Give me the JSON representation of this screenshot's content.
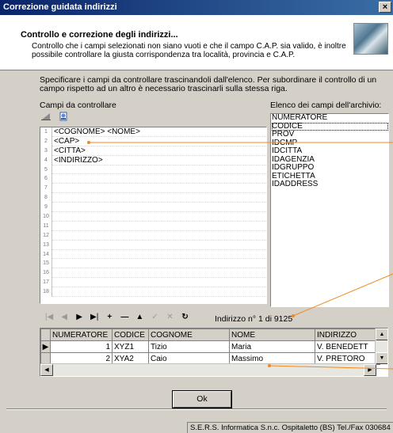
{
  "window": {
    "title": "Correzione guidata indirizzi",
    "close": "×"
  },
  "header": {
    "title": "Controllo e correzione degli indirizzi...",
    "description": "Controllo che i campi selezionati non siano vuoti e che il campo C.A.P. sia valido, è inoltre possibile controllare la giusta corrispondenza tra località, provincia e C.A.P."
  },
  "instructions": "Specificare i campi da controllare trascinandoli dall'elenco. Per subordinare il controllo di un campo rispetto ad un altro è necessario trascinarli sulla stessa riga.",
  "left_panel": {
    "label": "Campi da controllare",
    "lines": [
      "<COGNOME> <NOME>",
      "<CAP>",
      "<CITTA>",
      "<INDIRIZZO>",
      "",
      "",
      "",
      "",
      "",
      "",
      "",
      "",
      "",
      "",
      "",
      "",
      "",
      ""
    ],
    "line_numbers": [
      "1",
      "2",
      "3",
      "4",
      "5",
      "6",
      "7",
      "8",
      "9",
      "10",
      "11",
      "12",
      "13",
      "14",
      "15",
      "16",
      "17",
      "18"
    ]
  },
  "right_panel": {
    "label": "Elenco dei campi dell'archivio:",
    "items": [
      "NUMERATORE",
      "CODICE",
      "PROV",
      "IDCMP",
      "IDCITTA",
      "IDAGENZIA",
      "IDGRUPPO",
      "ETICHETTA",
      "IDADDRESS"
    ],
    "selected": "CODICE"
  },
  "navigator": {
    "buttons": [
      "first",
      "prior",
      "next",
      "last",
      "insert",
      "delete",
      "edit",
      "post",
      "cancel",
      "refresh"
    ],
    "record_label": "Indirizzo n° 1 di 9125"
  },
  "grid": {
    "columns": [
      "NUMERATORE",
      "CODICE",
      "COGNOME",
      "NOME",
      "INDIRIZZO"
    ],
    "rows": [
      [
        "1",
        "XYZ1",
        "Tizio",
        "Maria",
        "V. BENEDETT"
      ],
      [
        "2",
        "XYA2",
        "Caio",
        "Massimo",
        "V. PRETORO"
      ]
    ]
  },
  "ok_button": "Ok",
  "status": "S.E.R.S. Informatica S.n.c. Ospitaletto (BS) Tel./Fax 030684"
}
